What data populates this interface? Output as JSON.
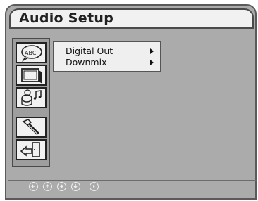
{
  "header": {
    "title": "Audio Setup"
  },
  "menu": {
    "items": [
      {
        "label": "Digital Out"
      },
      {
        "label": "Downmix"
      }
    ]
  },
  "sidebar": {
    "icons": [
      {
        "name": "language-icon",
        "text": "ABC"
      },
      {
        "name": "display-icon"
      },
      {
        "name": "audio-icon"
      },
      {
        "name": "tools-icon"
      },
      {
        "name": "exit-icon"
      }
    ]
  },
  "footer": {
    "nav_icons": [
      "left-arrow-icon",
      "up-arrow-icon",
      "right-arrow-icon",
      "down-arrow-icon",
      "play-icon"
    ]
  }
}
